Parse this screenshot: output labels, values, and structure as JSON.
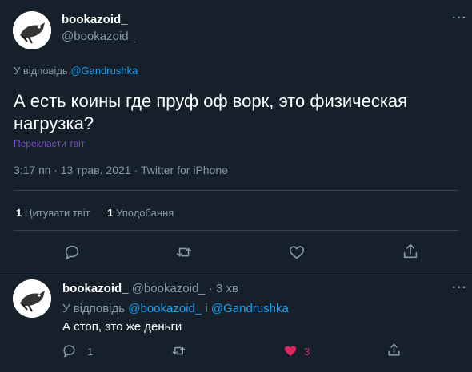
{
  "tweet": {
    "display_name": "bookazoid_",
    "handle": "@bookazoid_",
    "reply_prefix": "У відповідь",
    "reply_to": "@Gandrushka",
    "text_line1": "А есть коины где пруф оф ворк, это  физическая",
    "text_line2": "нагрузка?",
    "translate": "Перекласти твіт",
    "meta": "3:17 пп · 13 трав. 2021 · Twitter for iPhone",
    "quote_count": "1",
    "quote_label": "Цитувати твіт",
    "like_count": "1",
    "like_label": "Уподобання"
  },
  "reply": {
    "display_name": "bookazoid_",
    "handle": "@bookazoid_",
    "time": "· 3 хв",
    "reply_prefix": "У відповідь",
    "reply_to_1": "@bookazoid_",
    "and_word": "і",
    "reply_to_2": "@Gandrushka",
    "text": "А стоп, это же деньги",
    "reply_count": "1",
    "like_count": "3"
  },
  "icons": {
    "more": "more-dots-icon",
    "reply": "reply-icon",
    "retweet": "retweet-icon",
    "like": "like-icon",
    "share": "share-icon"
  },
  "colors": {
    "background": "#15202b",
    "accent": "#1da1f2",
    "muted": "#8899a6",
    "like_active": "#e0245e",
    "translate": "#794bc4"
  }
}
